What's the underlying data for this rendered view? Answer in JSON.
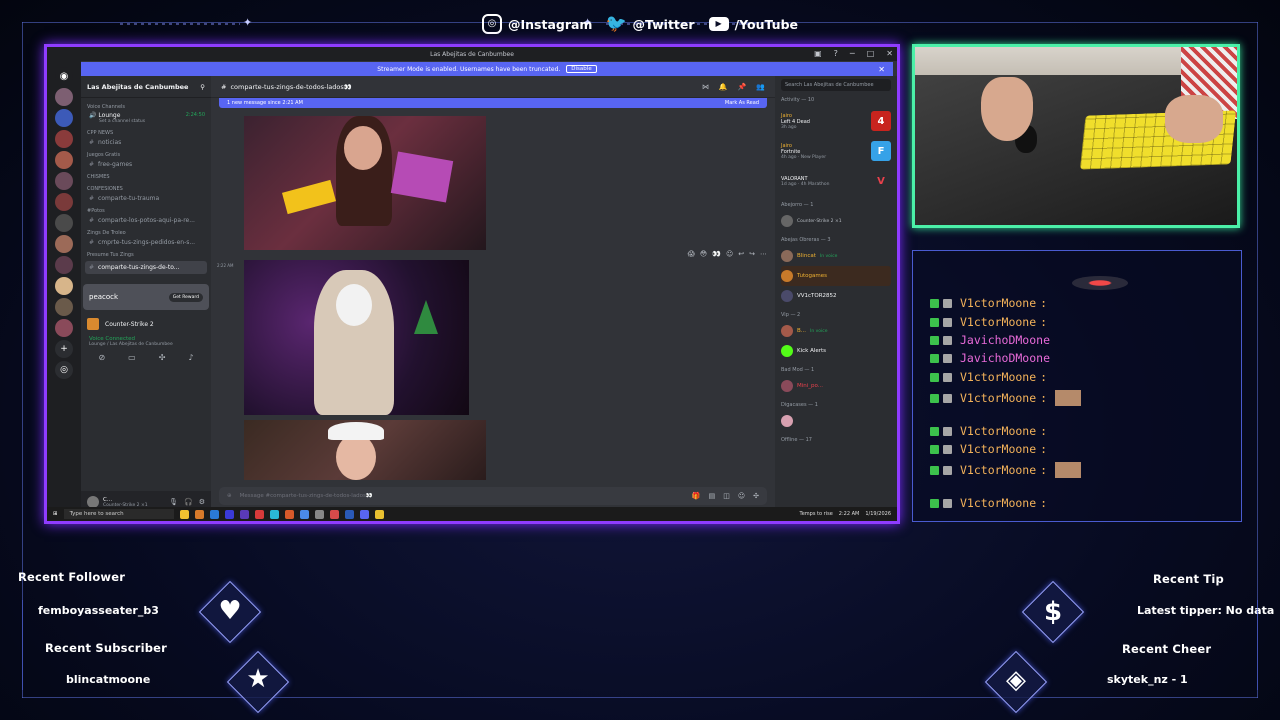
{
  "socials": {
    "instagram": "@Instagram",
    "twitter": "@Twitter",
    "youtube": "/YouTube"
  },
  "discord": {
    "window_title": "Las Abejitas de Canbumbee",
    "streamer_banner": "Streamer Mode is enabled. Usernames have been truncated.",
    "disable_label": "Disable",
    "server_name": "Las Abejitas de Canbumbee",
    "channel_header": "comparte-tus-zings-de-todos-lados👀",
    "new_message_bar": "1 new message since 2:21 AM",
    "mark_as_read": "Mark As Read",
    "search_placeholder": "Search Las Abejitas de Canbumbee",
    "composer_placeholder": "Message #comparte-tus-zings-de-todos-lados👀",
    "message_time": "2:22 AM",
    "sidebar": {
      "voice_category": "Voice Channels",
      "lounge": "Lounge",
      "lounge_status": "Set a channel status",
      "lounge_time": "2:24:50",
      "cpp_category": "CPP NEWS",
      "noticias": "noticias",
      "juegos_category": "Juegos Gratis",
      "free_games": "free-games",
      "chismes_category": "CHISMES",
      "confesiones_category": "CONFESIONES",
      "trauma": "comparte-tu-trauma",
      "potos_category": "#Potos",
      "potos": "comparte-los-potos-aqui-pa-re...",
      "zings_troleo_category": "Zings De Troleo",
      "zings_pedidos": "cmprte-tus-zings-pedidos-en-s...",
      "presume_category": "Presume Tus Zings",
      "active_channel": "comparte-tus-zings-de-to..."
    },
    "promo": {
      "brand": "peacock",
      "cta": "Get Reward"
    },
    "game_row": "Counter-Strike 2",
    "voice_connected": "Voice Connected",
    "voice_connected_sub": "Lounge / Las Abejitas de Canbumbee",
    "user_name": "C...",
    "user_sub": "Counter-Strike 2 ×1",
    "members": {
      "activity_header": "Activity — 10",
      "activities": [
        {
          "who": "Jairo",
          "game": "Left 4 Dead",
          "sub": "3h ago",
          "badge": "4",
          "color": "#c8241e"
        },
        {
          "who": "Jairo",
          "game": "Fortnite",
          "sub": "4h ago · New Player",
          "badge": "F",
          "color": "#36a2e8"
        },
        {
          "who": "",
          "game": "VALORANT",
          "sub": "1d ago · 4h Marathon",
          "badge": "V",
          "color": "#2b2d31"
        }
      ],
      "abejorro_header": "Abejorro — 1",
      "abejorro_sub": "Counter-Strike 2 ×1",
      "obreras_header": "Abejas Obreras — 3",
      "obreras": [
        "Blincat",
        "Tutogames",
        "VV1cTOR2852"
      ],
      "blincat_sub": "In voice",
      "vip_header": "Vip — 2",
      "vip": [
        "B...",
        "Kick Alerts"
      ],
      "vip_sub": "In voice",
      "badmod_header": "Bad Mod — 1",
      "badmod": [
        "Mini_po..."
      ],
      "digacases_header": "Digacases — 1",
      "offline_header": "Offline — 17"
    },
    "taskbar": {
      "search_placeholder": "Type here to search",
      "weather": "Temps to rise",
      "time": "2:22 AM",
      "date": "1/19/2026"
    }
  },
  "chat": [
    {
      "user": "V1ctorMoone",
      "suffix": ":",
      "color": "#f3b25a",
      "emote": false
    },
    {
      "user": "V1ctorMoone",
      "suffix": ":",
      "color": "#f3b25a",
      "emote": false
    },
    {
      "user": "JavichoDMoone",
      "suffix": "",
      "color": "#e86ad8",
      "emote": false
    },
    {
      "user": "JavichoDMoone",
      "suffix": "",
      "color": "#e86ad8",
      "emote": false
    },
    {
      "user": "V1ctorMoone",
      "suffix": ":",
      "color": "#f3b25a",
      "emote": false
    },
    {
      "user": "V1ctorMoone",
      "suffix": ":",
      "color": "#f3b25a",
      "emote": true
    },
    {
      "user": "V1ctorMoone",
      "suffix": ":",
      "color": "#f3b25a",
      "emote": false
    },
    {
      "user": "V1ctorMoone",
      "suffix": ":",
      "color": "#f3b25a",
      "emote": false
    },
    {
      "user": "V1ctorMoone",
      "suffix": ":",
      "color": "#f3b25a",
      "emote": true
    },
    {
      "user": "V1ctorMoone",
      "suffix": ":",
      "color": "#f3b25a",
      "emote": false
    }
  ],
  "widgets": {
    "recent_follower_label": "Recent Follower",
    "recent_follower": "femboyasseater_b3",
    "recent_subscriber_label": "Recent Subscriber",
    "recent_subscriber": "blincatmoone",
    "recent_tip_label": "Recent Tip",
    "recent_tip": "Latest tipper: No data",
    "recent_cheer_label": "Recent Cheer",
    "recent_cheer": "skytek_nz - 1"
  },
  "icons": {
    "follower": "heart-icon",
    "subscriber": "star-icon",
    "tip": "dollar-icon",
    "cheer": "diamond-icon"
  },
  "colors": {
    "discord_border": "#8f3cff",
    "cam_border": "#4bf0a8",
    "username_orange": "#f3b25a",
    "username_pink": "#e86ad8"
  }
}
